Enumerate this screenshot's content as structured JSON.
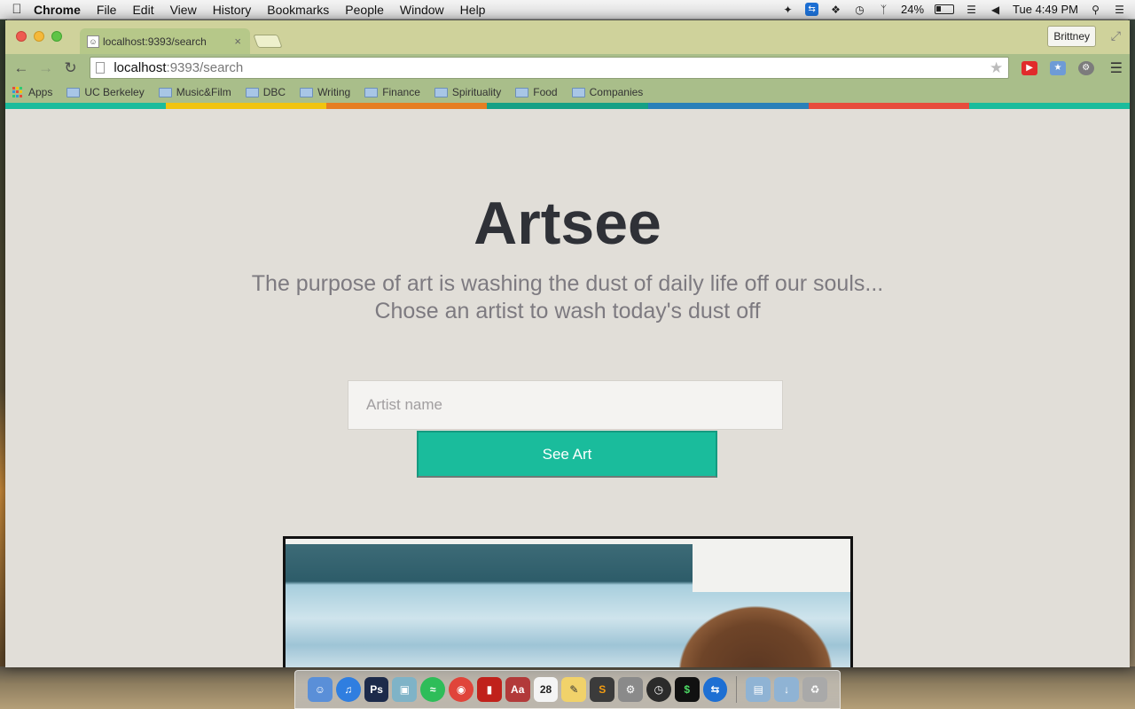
{
  "menubar": {
    "app_name": "Chrome",
    "menus": [
      "File",
      "Edit",
      "View",
      "History",
      "Bookmarks",
      "People",
      "Window",
      "Help"
    ],
    "battery": "24%",
    "clock": "Tue 4:49 PM"
  },
  "browser": {
    "tab_title": "localhost:9393/search",
    "tab_close": "×",
    "profile_name": "Brittney",
    "url_host": "localhost",
    "url_path": ":9393/search",
    "bookmarks": [
      "Apps",
      "UC Berkeley",
      "Music&Film",
      "DBC",
      "Writing",
      "Finance",
      "Spirituality",
      "Food",
      "Companies"
    ],
    "stripe_colors": [
      "#1abc9c",
      "#f1c40f",
      "#e67e22",
      "#16a085",
      "#2980b9",
      "#e74c3c",
      "#1abc9c"
    ]
  },
  "page": {
    "title": "Artsee",
    "tagline_line1": "The purpose of art is washing the dust of daily life off our souls...",
    "tagline_line2": "Chose an artist to wash today's dust off",
    "search_placeholder": "Artist name",
    "search_value": "",
    "submit_label": "See Art"
  },
  "dock": {
    "apps": [
      "finder-icon",
      "itunes-icon",
      "photoshop-icon",
      "preview-icon",
      "spotify-icon",
      "chrome-icon",
      "flashcards-icon",
      "dictionary-icon",
      "calendar-icon",
      "textedit-icon",
      "sublime-icon",
      "system-preferences-icon",
      "dashboard-icon",
      "terminal-icon",
      "teamviewer-icon",
      "documents-folder-icon",
      "downloads-folder-icon",
      "trash-icon"
    ],
    "calendar_day": "28"
  },
  "colors": {
    "accent": "#1abc9c",
    "page_bg": "#e1ded8",
    "title": "#2f3137",
    "tagline": "#7d7a80",
    "chrome_theme": "#a9be8a"
  }
}
